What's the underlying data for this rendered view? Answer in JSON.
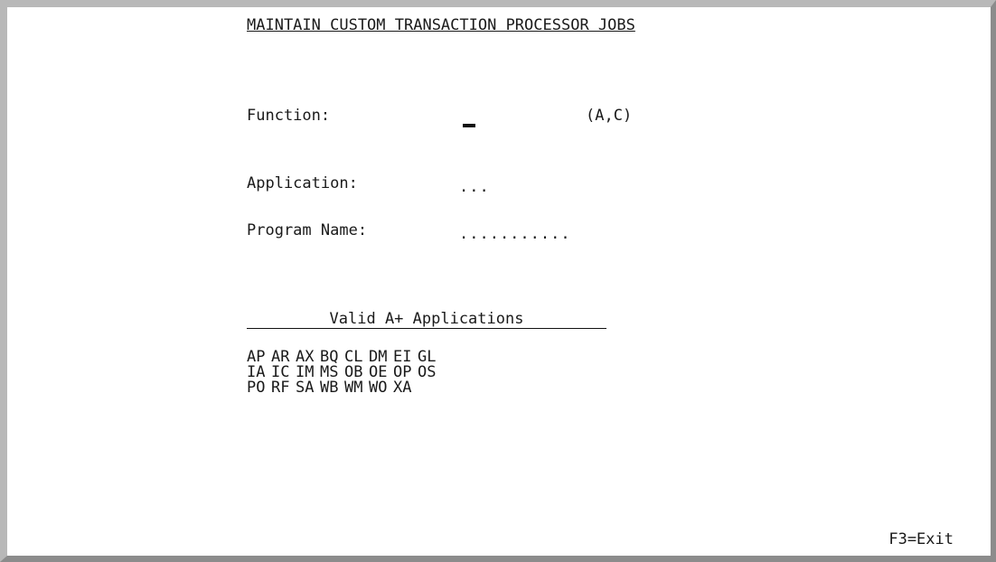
{
  "screen": {
    "title": "MAINTAIN CUSTOM TRANSACTION PROCESSOR JOBS",
    "fields": {
      "function_label": "Function:",
      "function_value": "",
      "function_hint": "(A,C)",
      "application_label": "Application:",
      "application_placeholder": "...",
      "program_label": "Program Name:",
      "program_placeholder": "..........."
    },
    "valid_apps": {
      "heading": "Valid A+ Applications",
      "rows": [
        [
          "AP",
          "AR",
          "AX",
          "BQ",
          "CL",
          "DM",
          "EI",
          "GL"
        ],
        [
          "IA",
          "IC",
          "IM",
          "MS",
          "OB",
          "OE",
          "OP",
          "OS"
        ],
        [
          "PO",
          "RF",
          "SA",
          "WB",
          "WM",
          "WO",
          "XA"
        ]
      ]
    },
    "footer": {
      "f3": "F3=Exit"
    }
  }
}
